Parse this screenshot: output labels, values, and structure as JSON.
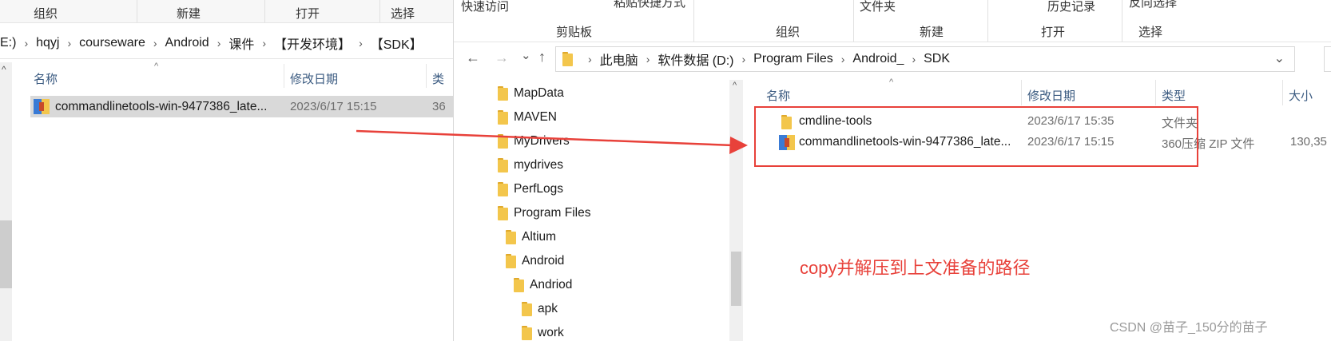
{
  "left_window": {
    "ribbon": [
      "组织",
      "新建",
      "打开",
      "选择"
    ],
    "breadcrumb": [
      "E:)",
      "hqyj",
      "courseware",
      "Android",
      "课件",
      "【开发环境】",
      "【SDK】"
    ],
    "columns": {
      "name": "名称",
      "date": "修改日期",
      "type": "类"
    },
    "rows": [
      {
        "name": "commandlinetools-win-9477386_late...",
        "date": "2023/6/17 15:15",
        "type": "36"
      }
    ]
  },
  "right_window": {
    "ribbon_top": [
      "快速访问",
      "粘贴快捷方式",
      "文件夹",
      "历史记录",
      "反向选择"
    ],
    "ribbon": [
      "剪贴板",
      "组织",
      "新建",
      "打开",
      "选择"
    ],
    "nav": {
      "back": "←",
      "forward": "→",
      "recent": "⌄",
      "up": "↑"
    },
    "breadcrumb": [
      "此电脑",
      "软件数据 (D:)",
      "Program Files",
      "Android_",
      "SDK"
    ],
    "tree": [
      {
        "label": "MapData",
        "level": 0
      },
      {
        "label": "MAVEN",
        "level": 0
      },
      {
        "label": "MyDrivers",
        "level": 0
      },
      {
        "label": "mydrives",
        "level": 0
      },
      {
        "label": "PerfLogs",
        "level": 0
      },
      {
        "label": "Program Files",
        "level": 0
      },
      {
        "label": "Altium",
        "level": 1
      },
      {
        "label": "Android",
        "level": 1
      },
      {
        "label": "Andriod",
        "level": 2
      },
      {
        "label": "apk",
        "level": 3
      },
      {
        "label": "work",
        "level": 3
      }
    ],
    "columns": {
      "name": "名称",
      "date": "修改日期",
      "type": "类型",
      "size": "大小"
    },
    "rows": [
      {
        "name": "cmdline-tools",
        "date": "2023/6/17 15:35",
        "type": "文件夹",
        "size": "",
        "icon": "folder-icon"
      },
      {
        "name": "commandlinetools-win-9477386_late...",
        "date": "2023/6/17 15:15",
        "type": "360压缩 ZIP 文件",
        "size": "130,35",
        "icon": "zip-archive-icon"
      }
    ]
  },
  "annotation": {
    "text": "copy并解压到上文准备的路径",
    "color": "#e8413a"
  },
  "watermark": "CSDN @苗子_150分的苗子"
}
